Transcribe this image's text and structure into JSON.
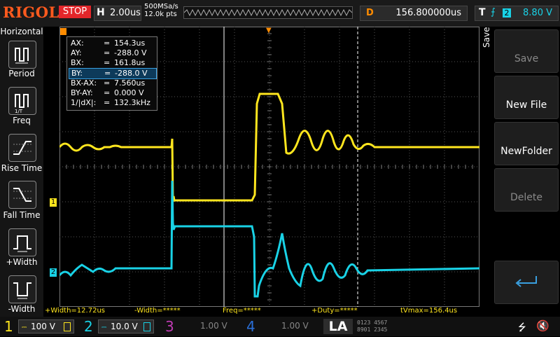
{
  "header": {
    "brand": "RIGOL",
    "run_state": "STOP",
    "horizontal_key": "H",
    "timebase": "2.00us",
    "sample_rate": "500MSa/s",
    "memory_depth": "12.0k pts",
    "delay_key": "D",
    "delay_value": "156.800000us",
    "trigger_key": "T",
    "trigger_source": "2",
    "trigger_level": "8.80 V"
  },
  "left_menu": {
    "title": "Horizontal",
    "items": [
      {
        "label": "Period",
        "icon": "period-icon"
      },
      {
        "label": "Freq",
        "icon": "freq-icon"
      },
      {
        "label": "Rise Time",
        "icon": "rise-time-icon"
      },
      {
        "label": "Fall Time",
        "icon": "fall-time-icon"
      },
      {
        "label": "+Width",
        "icon": "pos-width-icon"
      },
      {
        "label": "-Width",
        "icon": "neg-width-icon"
      }
    ]
  },
  "right_menu": {
    "section": "Save",
    "buttons": [
      {
        "label": "Save",
        "enabled": false
      },
      {
        "label": "New File",
        "enabled": true
      },
      {
        "label": "NewFolder",
        "enabled": true
      },
      {
        "label": "Delete",
        "enabled": false
      },
      {
        "label": "",
        "icon": "enter-icon",
        "enabled": true
      }
    ]
  },
  "cursor_readout": {
    "rows": [
      {
        "name": "AX:",
        "value": "154.3us"
      },
      {
        "name": "AY:",
        "value": "-288.0 V"
      },
      {
        "name": "BX:",
        "value": "161.8us"
      },
      {
        "name": "BY:",
        "value": "-288.0 V"
      },
      {
        "name": "BX-AX:",
        "value": "7.560us"
      },
      {
        "name": "BY-AY:",
        "value": "0.000 V"
      },
      {
        "name": "1/|dX|:",
        "value": "132.3kHz"
      }
    ],
    "eq": "="
  },
  "channel_markers": {
    "ch1": "1",
    "ch2": "2",
    "trig": "T"
  },
  "measurements": {
    "pos_width": "+Width=12.72us",
    "neg_width": "-Width=*****",
    "freq": "Freq=*****",
    "pos_duty": "+Duty=*****",
    "tvmax": "tVmax=156.4us"
  },
  "channels": [
    {
      "num": "1",
      "scale": "100 V",
      "color": "#ffe61e",
      "active": true
    },
    {
      "num": "2",
      "scale": "10.0 V",
      "color": "#19d2e6",
      "active": true
    },
    {
      "num": "3",
      "scale": "1.00 V",
      "color": "#c13bb5",
      "active": false
    },
    {
      "num": "4",
      "scale": "1.00 V",
      "color": "#2a6fd8",
      "active": false
    }
  ],
  "la_label": "LA",
  "la_digits": [
    "0123 4567",
    "8901 2345"
  ],
  "colors": {
    "ch1": "#ffe61e",
    "ch2": "#19d2e6",
    "accent": "#ff8c00"
  }
}
